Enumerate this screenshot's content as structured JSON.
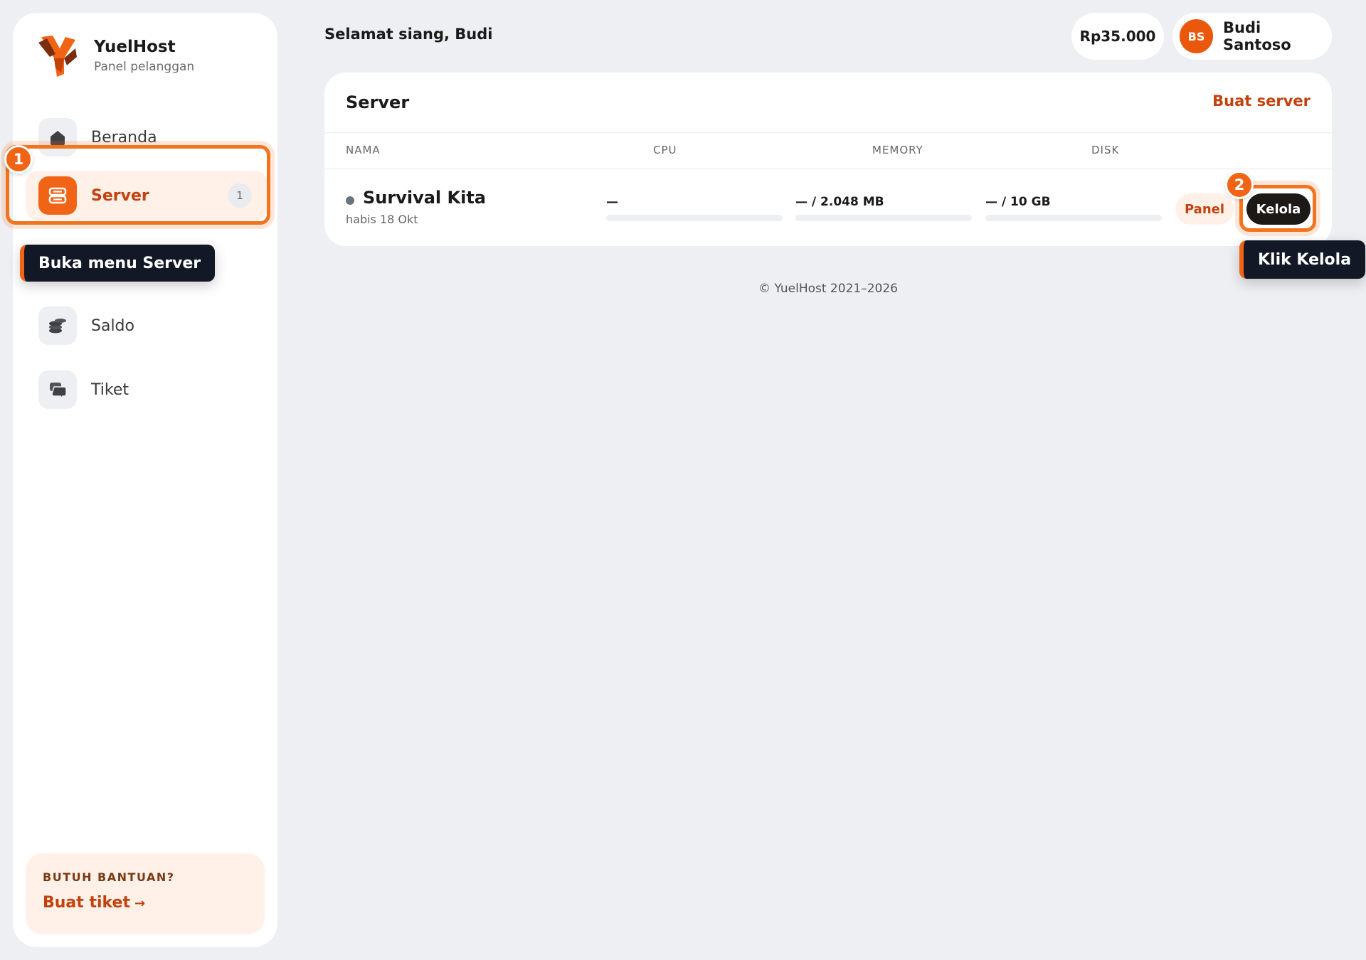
{
  "brand": {
    "name": "YuelHost",
    "subtitle": "Panel pelanggan",
    "logo_icon": "yuelhost-logo"
  },
  "sidebar": {
    "items": [
      {
        "label": "Beranda",
        "icon": "home-icon"
      },
      {
        "label": "Server",
        "icon": "server-icon",
        "badge": "1",
        "active": true
      },
      {
        "label": "Saldo",
        "icon": "coins-icon"
      },
      {
        "label": "Tiket",
        "icon": "chat-icon"
      }
    ],
    "help": {
      "title": "BUTUH BANTUAN?",
      "link": "Buat tiket",
      "arrow": "→"
    }
  },
  "header": {
    "greeting": "Selamat siang, Budi",
    "balance": "Rp35.000",
    "user": {
      "initials": "BS",
      "name": "Budi Santoso"
    }
  },
  "servers": {
    "title": "Server",
    "create_label": "Buat server",
    "columns": [
      "NAMA",
      "CPU",
      "MEMORY",
      "DISK"
    ],
    "rows": [
      {
        "name": "Survival Kita",
        "expiry": "habis 18 Okt",
        "cpu": "—",
        "memory": "— / 2.048 MB",
        "disk": "— / 10 GB",
        "cpu_usage": 0,
        "memory_usage": 0,
        "disk_usage": 0,
        "panel_label": "Panel",
        "manage_label": "Kelola"
      }
    ]
  },
  "tour": {
    "step1": {
      "number": "1",
      "text": "Buka menu Server"
    },
    "step2": {
      "number": "2",
      "text": "Klik Kelola"
    }
  },
  "footer": "© YuelHost 2021–2026",
  "colors": {
    "accent": "#f26415",
    "accent_text": "#c2410c",
    "accent_soft": "#fff0e8",
    "dark": "#1c1917",
    "background": "#eeeff2"
  }
}
